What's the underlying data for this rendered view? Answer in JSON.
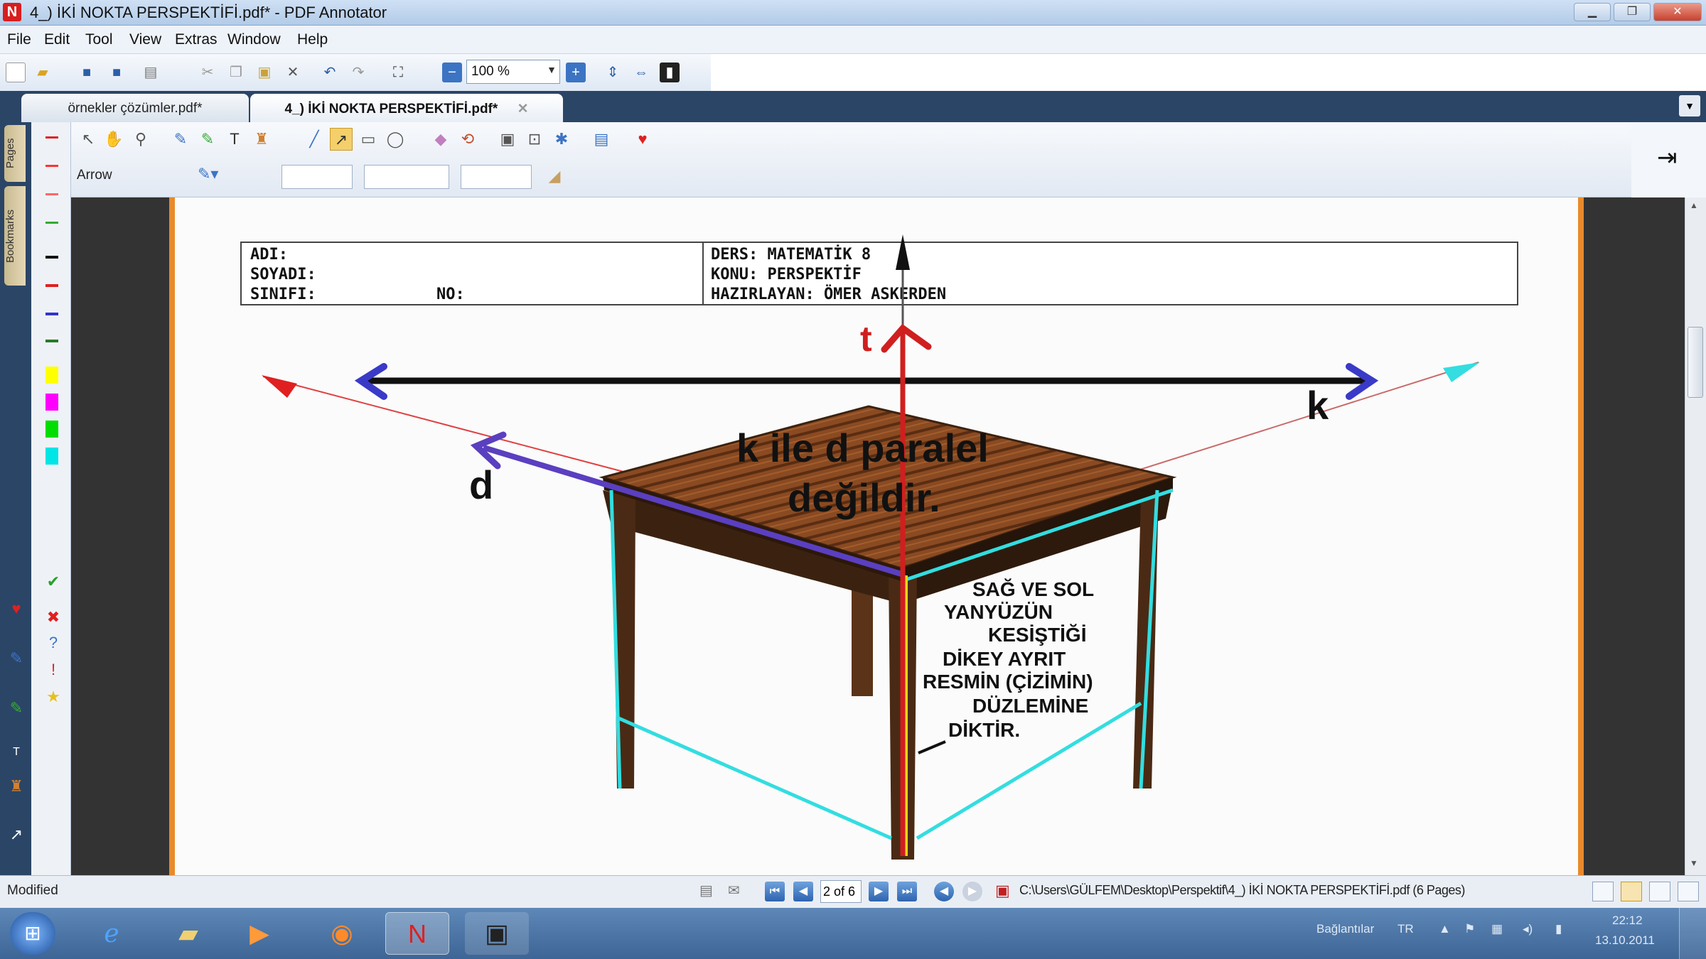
{
  "window": {
    "title": "4_) İKİ NOKTA PERSPEKTİFİ.pdf* - PDF Annotator",
    "app_icon": "pdf-annotator-icon",
    "controls": [
      "minimize",
      "restore",
      "close"
    ]
  },
  "menu": [
    "File",
    "Edit",
    "Tool",
    "View",
    "Extras",
    "Window",
    "Help"
  ],
  "toolbar": {
    "zoom_value": "100 %"
  },
  "tabs": [
    {
      "label": "örnekler çözümler.pdf*",
      "active": false
    },
    {
      "label": "4_) İKİ NOKTA PERSPEKTİFİ.pdf*",
      "active": true
    }
  ],
  "side_tabs": [
    "Pages",
    "Bookmarks"
  ],
  "annotation_toolbar": {
    "current_tool": "Arrow"
  },
  "palette_colors": [
    "#e02020",
    "#ff3333",
    "#ff6666",
    "#33aa33",
    "#111111",
    "#e02020",
    "#3333cc",
    "#2a7a2a",
    "#ffff00",
    "#ff00ff",
    "#00dd00",
    "#00e5e5"
  ],
  "document": {
    "header": {
      "adi": "ADI:",
      "soyadi": "SOYADI:",
      "sinifi": "SINIFI:",
      "no": "NO:",
      "ders": "DERS: MATEMATİK 8",
      "konu": "KONU: PERSPEKTİF",
      "hazirlayan": "HAZIRLAYAN: ÖMER ASKERDEN"
    },
    "labels": {
      "t": "t",
      "k": "k",
      "d": "d",
      "statement_line1": "k ile d paralel",
      "statement_line2": "değildir.",
      "note": [
        "SAĞ VE SOL",
        "YANYÜZÜN",
        "KESİŞTİĞİ",
        "DİKEY AYRIT",
        "RESMİN (ÇİZİMİN)",
        "DÜZLEMİNE",
        "DİKTİR."
      ]
    },
    "colors": {
      "line_k": "#111111",
      "line_d": "#5a3fc0",
      "line_t": "#d01f1f",
      "edges": "#33dde0",
      "page_border": "#e88a2b"
    }
  },
  "status": {
    "state": "Modified",
    "page_indicator": "2 of 6",
    "file_path": "C:\\Users\\GÜLFEM\\Desktop\\Perspektif\\4_) İKİ NOKTA PERSPEKTİFİ.pdf (6 Pages)"
  },
  "taskbar": {
    "language": "TR",
    "connection": "Bağlantılar",
    "time": "22:12",
    "date": "13.10.2011"
  }
}
